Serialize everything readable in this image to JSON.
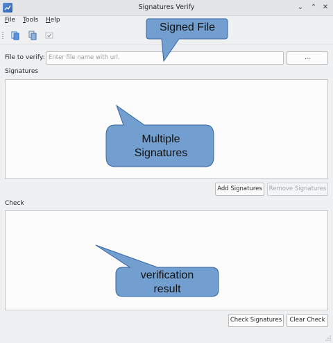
{
  "window": {
    "title": "Signatures Verify",
    "controls": [
      "⌄",
      "⌃",
      "✕"
    ]
  },
  "menu": [
    {
      "mnemonic": "F",
      "rest": "ile"
    },
    {
      "mnemonic": "T",
      "rest": "ools"
    },
    {
      "mnemonic": "H",
      "rest": "elp"
    }
  ],
  "toolbar": {
    "icons": [
      "open-file-icon",
      "copy-icon",
      "check-icon"
    ]
  },
  "file": {
    "label": "File to verify:",
    "placeholder": "Enter file name with url.",
    "browse_label": "..."
  },
  "signatures": {
    "label": "Signatures",
    "add_label": "Add Signatures",
    "remove_label": "Remove Signatures"
  },
  "check": {
    "label": "Check",
    "check_label": "Check Signatures",
    "clear_label": "Clear Check"
  },
  "annotations": {
    "signed_file": "Signed File",
    "multiple_line1": "Multiple",
    "multiple_line2": "Signatures",
    "verification_line1": "verification",
    "verification_line2": "result",
    "fill_color": "#729fcf",
    "stroke_color": "#3465a4"
  }
}
